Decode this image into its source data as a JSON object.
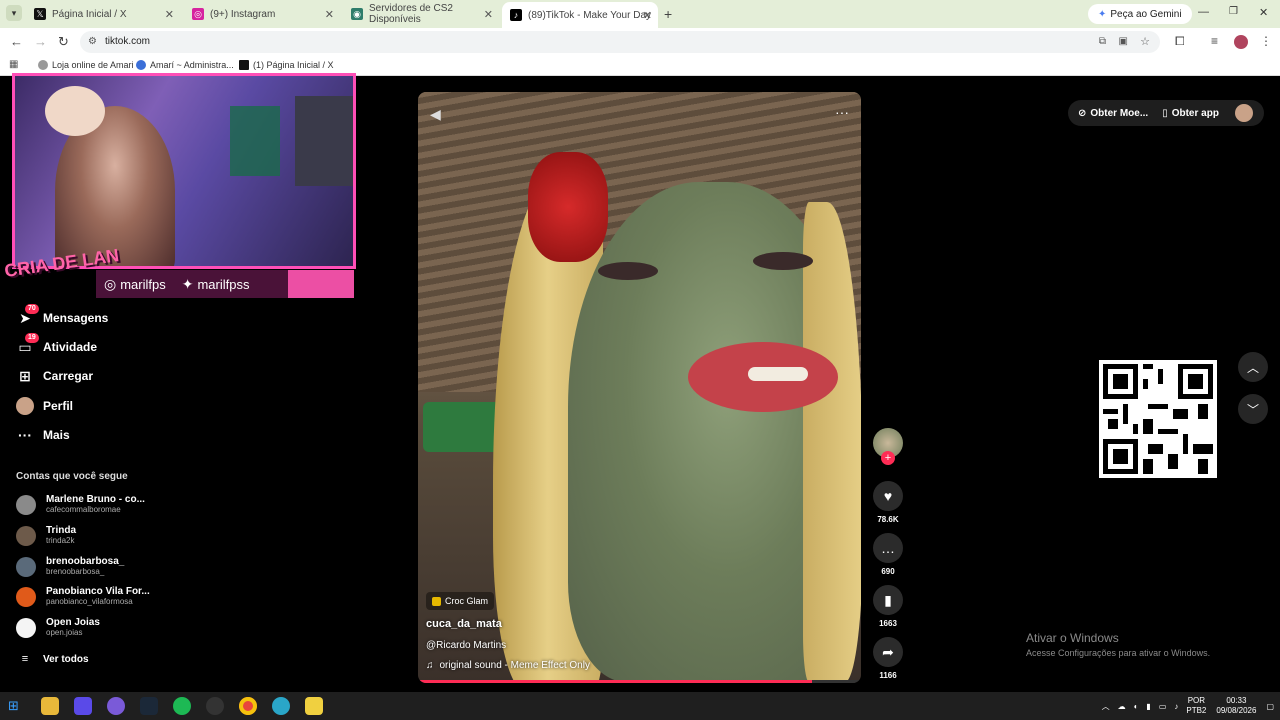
{
  "browser": {
    "tabs": [
      {
        "title": "Página Inicial / X",
        "icon": "x-icon",
        "color": "#111111"
      },
      {
        "title": "(9+) Instagram",
        "icon": "instagram-icon",
        "color": "#d6249f"
      },
      {
        "title": "Servidores de CS2 Disponíveis",
        "icon": "cs2-server-icon",
        "color": "#2e7d6b"
      },
      {
        "title": "(89)TikTok - Make Your Day",
        "icon": "tiktok-icon",
        "color": "#000000"
      }
    ],
    "gemini_label": "Peça ao Gemini",
    "url": "tiktok.com",
    "bookmarks": [
      "Loja online de Amari",
      "Amarí ~ Administra...",
      "(1) Página Inicial / X"
    ]
  },
  "overlay": {
    "brand": "CRIA DE LAN",
    "instagram_handle": "marilfps",
    "twitter_handle": "marilfpss"
  },
  "sidebar": {
    "items": [
      {
        "label": "Mensagens",
        "badge": "70",
        "icon": "send-icon"
      },
      {
        "label": "Atividade",
        "badge": "19",
        "icon": "activity-icon"
      },
      {
        "label": "Carregar",
        "badge": "",
        "icon": "upload-icon"
      },
      {
        "label": "Perfil",
        "badge": "",
        "icon": "profile-avatar"
      },
      {
        "label": "Mais",
        "badge": "",
        "icon": "more-icon"
      }
    ],
    "following_title": "Contas que você segue",
    "accounts": [
      {
        "name": "Marlene Bruno - co...",
        "handle": "cafecommalboromae",
        "color": "#8a8a8a"
      },
      {
        "name": "Trinda",
        "handle": "trinda2k",
        "color": "#6d5a4a"
      },
      {
        "name": "brenoobarbosa_",
        "handle": "brenoobarbosa_",
        "color": "#5a6a7a"
      },
      {
        "name": "Panobianco Vila For...",
        "handle": "panobianco_vilaformosa",
        "color": "#e05a1a"
      },
      {
        "name": "Open Joias",
        "handle": "open.joias",
        "color": "#f4f4f4"
      }
    ],
    "see_all": "Ver todos"
  },
  "video": {
    "effect": "Croc Glam",
    "username": "cuca_da_mata",
    "mention": "@Ricardo Martins",
    "sound": "original sound - Meme Effect Only",
    "progress": 0.89,
    "likes": "78.6K",
    "comments": "690",
    "saves": "1663",
    "shares": "1166"
  },
  "header_right": {
    "coins": "Obter Moe...",
    "app": "Obter app"
  },
  "watermark": {
    "title": "Ativar o Windows",
    "subtitle": "Acesse Configurações para ativar o Windows."
  },
  "tray": {
    "lang": "POR",
    "layout": "PTB2",
    "time": "00:33",
    "date": "09/08/2026"
  },
  "colors": {
    "accent": "#fe2c55",
    "overlay_pink": "#ec4fa4"
  }
}
